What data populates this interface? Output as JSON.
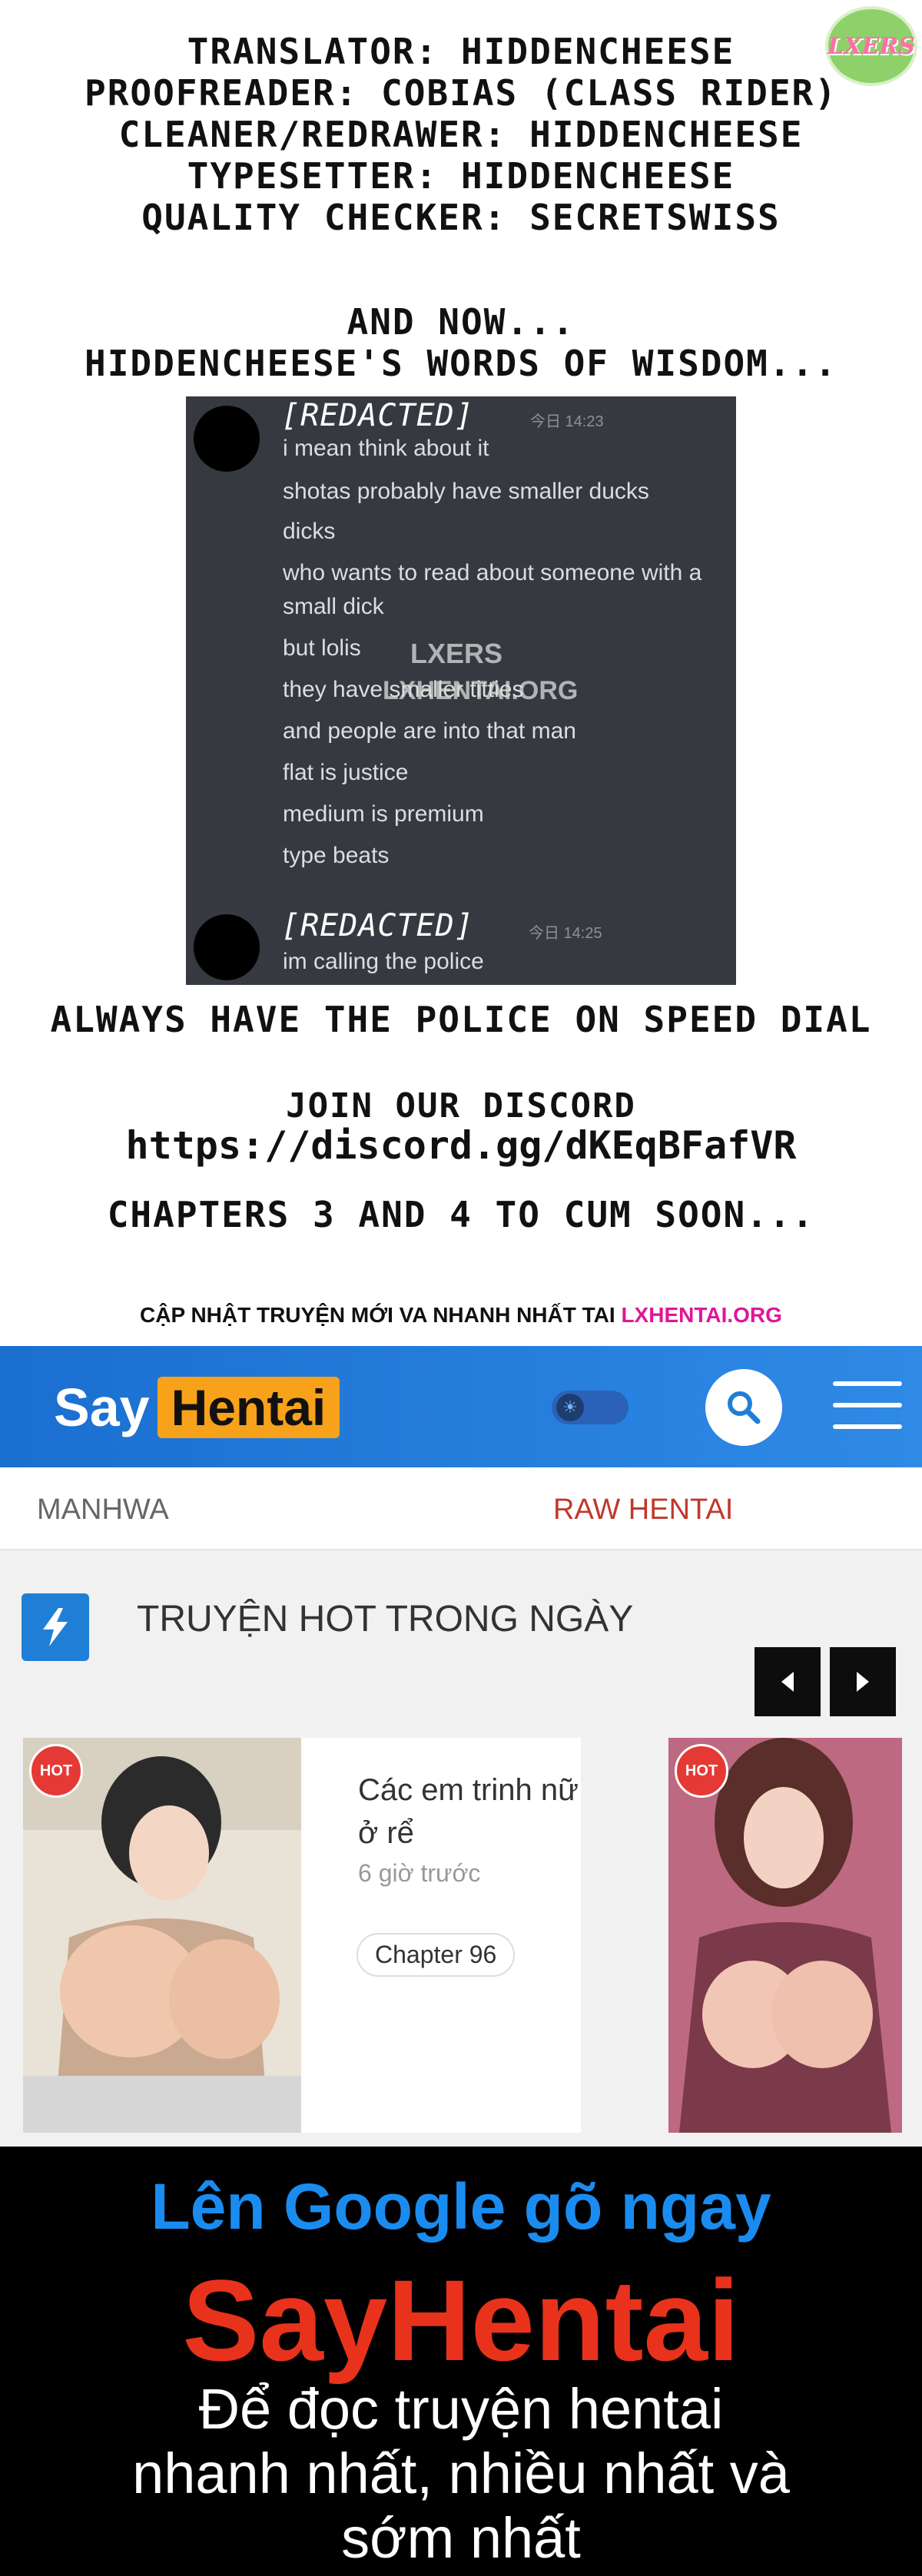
{
  "credits": {
    "lines": [
      "Translator: HiddenCheese",
      "Proofreader: Cobias (class rider)",
      "Cleaner/Redrawer: HiddenCheese",
      "Typesetter: HiddenCheese",
      "Quality Checker: SecretSwiss"
    ],
    "logo_text": "LXERS"
  },
  "wisdom": {
    "line1": "And now...",
    "line2": "HiddenCheese's words of wisdom..."
  },
  "chat": {
    "first": {
      "username": "[REDACTED]",
      "timestamp": "今日 14:23",
      "messages": [
        "i mean think about it",
        "shotas probably have smaller ducks",
        "dicks",
        "who wants to read about someone with a",
        "small dick",
        "but lolis",
        "they have smaller titties",
        "and people are into that man",
        "flat is justice",
        "medium is premium",
        "type beats"
      ]
    },
    "second": {
      "username": "[REDACTED]",
      "timestamp": "今日 14:25",
      "messages": [
        "im calling the police"
      ]
    },
    "watermark_1": "LXERS",
    "watermark_2": "LXHENTAI.ORG"
  },
  "captions": {
    "police": "Always have the police on speed dial",
    "discord_join": "Join our discord",
    "discord_link": "https://discord.gg/dKEqBFafVR",
    "chapters": "Chapters 3 and 4 to cum soon..."
  },
  "update": {
    "prefix": "CẬP NHẬT TRUYỆN MỚI VA NHANH NHẤT TAI",
    "link": "LXHENTAI.ORG"
  },
  "site": {
    "brand_say": "Say",
    "brand_hentai": "Hentai",
    "nav_manhwa": "MANHWA",
    "nav_raw": "RAW HENTAI",
    "hot_title": "TRUYỆN HOT TRONG NGÀY",
    "cards": [
      {
        "badge": "HOT",
        "title": "Các em trinh nữ ở rể",
        "time": "6 giờ trước",
        "chapter": "Chapter 96"
      },
      {
        "badge": "HOT"
      }
    ]
  },
  "banner": {
    "line1": "Lên Google gõ ngay",
    "line2": "SayHentai",
    "line3": "Để đọc truyện hentai",
    "line4": "nhanh nhất, nhiều nhất và",
    "line5": "sớm nhất"
  },
  "colors": {
    "header_blue": "#1f7fd6",
    "brand_orange": "#f7a21a",
    "link_magenta": "#e0169a",
    "banner_blue": "#1a8cf0",
    "banner_red": "#e8321c",
    "chat_bg": "#36393f"
  }
}
